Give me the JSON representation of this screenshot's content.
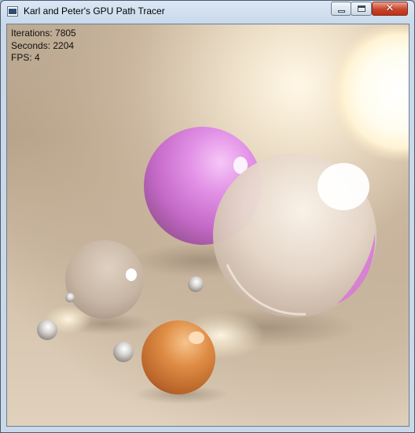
{
  "window": {
    "title": "Karl and Peter's GPU Path Tracer",
    "controls": {
      "minimize_icon": "minimize-icon",
      "maximize_icon": "maximize-icon",
      "close_icon": "close-icon",
      "close_glyph": "✕"
    },
    "accent_close": "#c9442a"
  },
  "stats": {
    "iterations": "Iterations: 7805",
    "seconds": "Seconds: 2204",
    "fps": "FPS: 4"
  },
  "scene": {
    "background_color": "#c9b59d",
    "light_color": "#fffbe8",
    "sphere_colors": {
      "magenta": "#d77fd8",
      "glass": "#e8ddd2",
      "orange": "#d07a3a",
      "metal": "#d8d8d8"
    }
  }
}
